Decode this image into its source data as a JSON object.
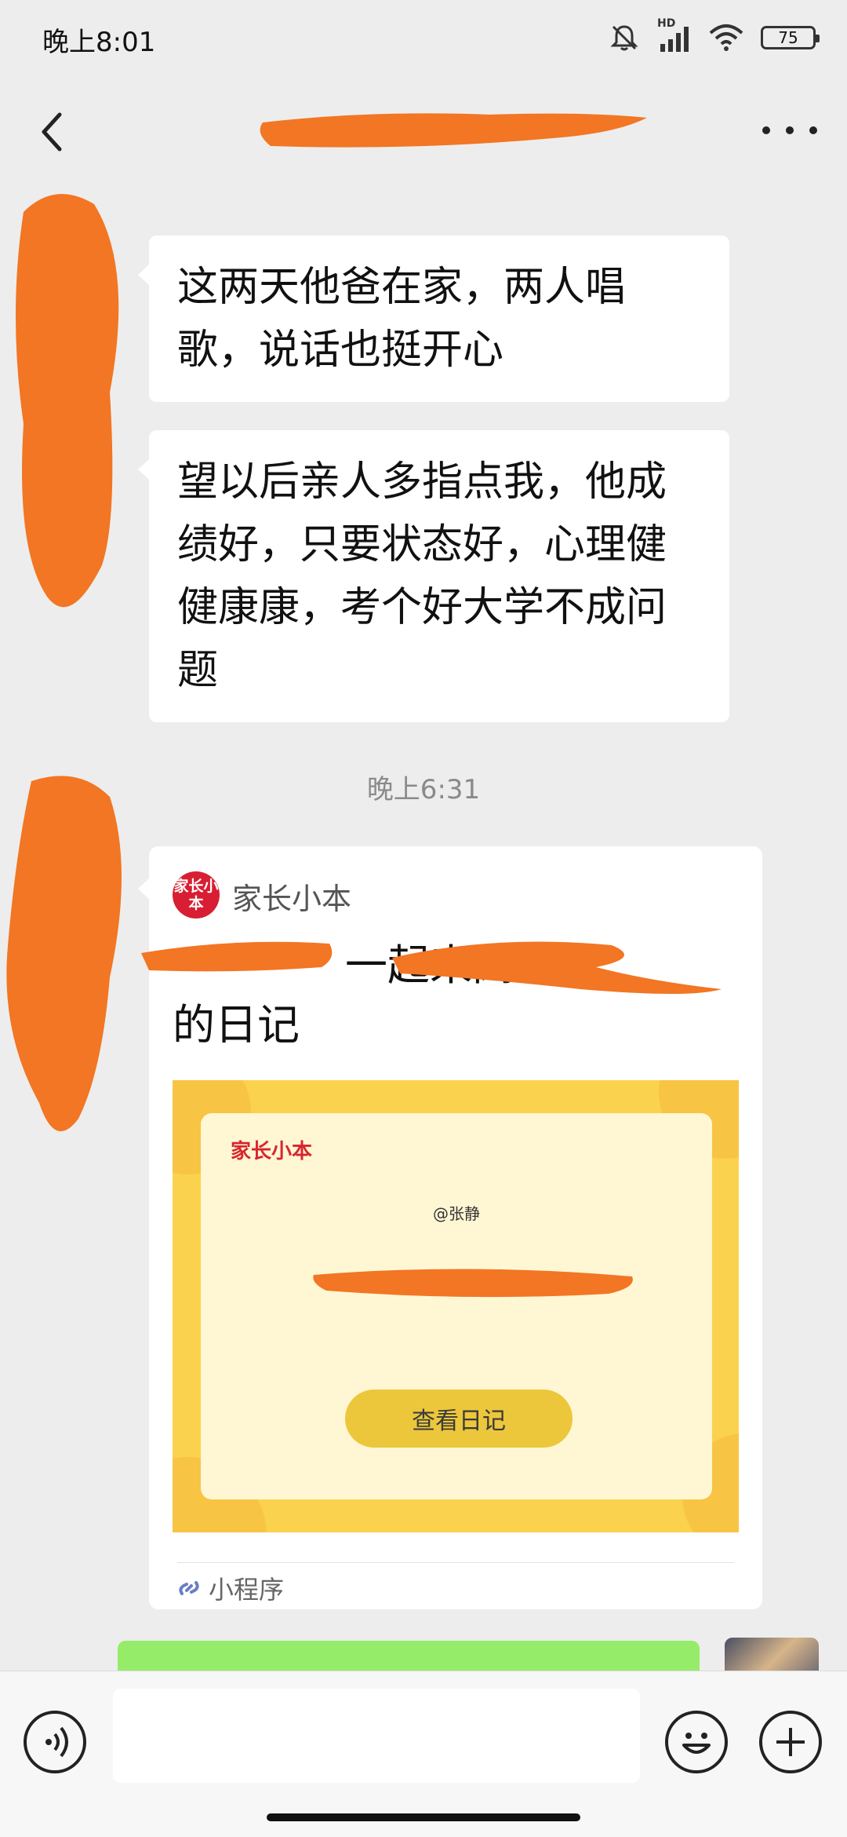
{
  "status_bar": {
    "time": "晚上8:01",
    "battery": "75",
    "network_label": "HD",
    "icons": [
      "mute-icon",
      "signal-icon",
      "wifi-icon",
      "battery-icon"
    ]
  },
  "nav": {
    "title_redacted": true,
    "back_icon": "chevron-left-icon",
    "more_icon": "more-icon"
  },
  "messages": [
    {
      "side": "left",
      "text": "这两天他爸在家，两人唱歌，说话也挺开心"
    },
    {
      "side": "left",
      "text": "望以后亲人多指点我，他成绩好，只要状态好，心理健健康康，考个好大学不成问题"
    }
  ],
  "timestamp": "晚上6:31",
  "mini_program_card": {
    "logo_text": "家长小本",
    "source_name": "家长小本",
    "headline_visible_part1": "一起来阅",
    "headline_line2": "的日记",
    "preview": {
      "brand": "家长小本",
      "mention": "@张静",
      "button_label": "查看日记"
    },
    "footer_label": "小程序"
  },
  "colors": {
    "background": "#ededed",
    "bubble_left": "#ffffff",
    "bubble_right": "#95ec69",
    "redaction": "#f27623",
    "preview_yellow": "#fbd24d",
    "brand_red": "#d81e32"
  }
}
